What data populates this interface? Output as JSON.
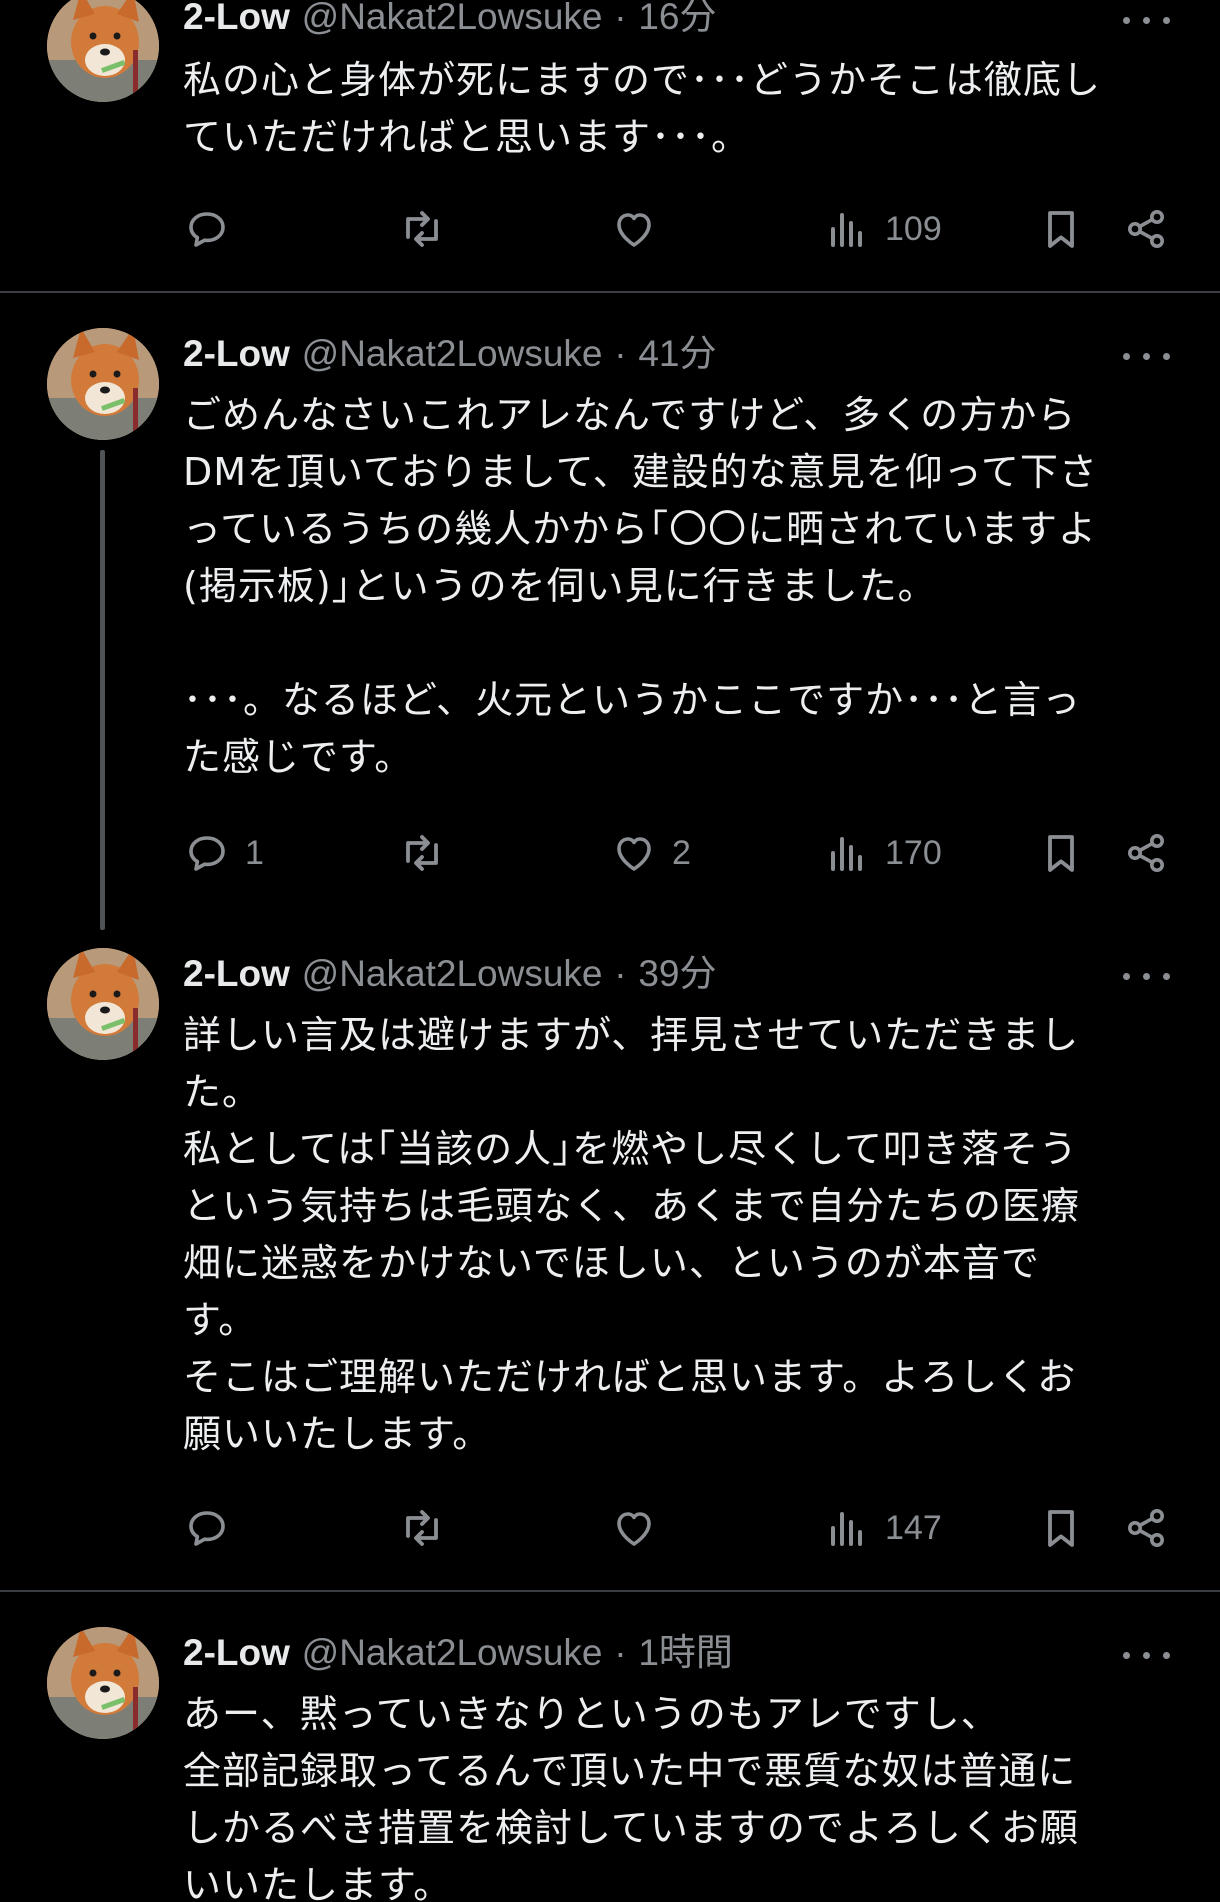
{
  "tweets": [
    {
      "name": "2-Low",
      "handle": "@Nakat2Lowsuke",
      "sep": "·",
      "time": "16分",
      "text": "私の心と身体が死にますので･･･どうかそこは徹底し\nていただければと思います･･･。",
      "reply_count": "",
      "retweet_count": "",
      "like_count": "",
      "views": "109"
    },
    {
      "name": "2-Low",
      "handle": "@Nakat2Lowsuke",
      "sep": "·",
      "time": "41分",
      "text": "ごめんなさいこれアレなんですけど、多くの方から\nDMを頂いておりまして、建設的な意見を仰って下さ\nっているうちの幾人かから｢〇〇に晒されていますよ\n(掲示板)｣というのを伺い見に行きました。\n\n･･･。なるほど、火元というかここですか･･･と言っ\nた感じです。",
      "reply_count": "1",
      "retweet_count": "",
      "like_count": "2",
      "views": "170"
    },
    {
      "name": "2-Low",
      "handle": "@Nakat2Lowsuke",
      "sep": "·",
      "time": "39分",
      "text": "詳しい言及は避けますが、拝見させていただきまし\nた。\n私としては｢当該の人｣を燃やし尽くして叩き落そう\nという気持ちは毛頭なく、あくまで自分たちの医療\n畑に迷惑をかけないでほしい、というのが本音で\nす。\nそこはご理解いただければと思います。よろしくお\n願いいたします。",
      "reply_count": "",
      "retweet_count": "",
      "like_count": "",
      "views": "147"
    },
    {
      "name": "2-Low",
      "handle": "@Nakat2Lowsuke",
      "sep": "·",
      "time": "1時間",
      "text": "あー、黙っていきなりというのもアレですし、\n全部記録取ってるんで頂いた中で悪質な奴は普通に\nしかるべき措置を検討していますのでよろしくお願\nいいたします。",
      "reply_count": "",
      "retweet_count": "",
      "like_count": "",
      "views": ""
    }
  ],
  "icons": {
    "reply": "reply-icon",
    "retweet": "retweet-icon",
    "like": "heart-icon",
    "views": "views-icon",
    "bookmark": "bookmark-icon",
    "share": "share-icon",
    "more": "more-icon"
  },
  "colors": {
    "background": "#000000",
    "text": "#e7e9ea",
    "secondary": "#8b8f94",
    "divider": "#3a3d41"
  }
}
